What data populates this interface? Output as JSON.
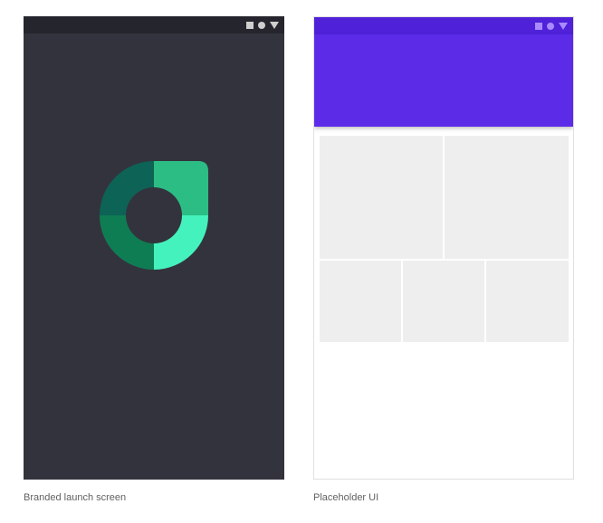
{
  "captions": {
    "left": "Branded launch screen",
    "right": "Placeholder UI"
  },
  "icons": {
    "status_square": "square-icon",
    "status_circle": "circle-icon",
    "status_triangle": "triangle-icon",
    "brand_logo": "brand-logo-icon"
  },
  "colors": {
    "launch_background": "#33333d",
    "launch_status_bar": "#25252d",
    "app_bar": "#5c2be8",
    "app_status_bar": "#4f21d9",
    "placeholder_tile": "#eeeeee",
    "logo_dark_teal": "#0d6355",
    "logo_light_green": "#2cbd85",
    "logo_dark_green": "#0f7d54",
    "logo_mint": "#44f2bd"
  }
}
